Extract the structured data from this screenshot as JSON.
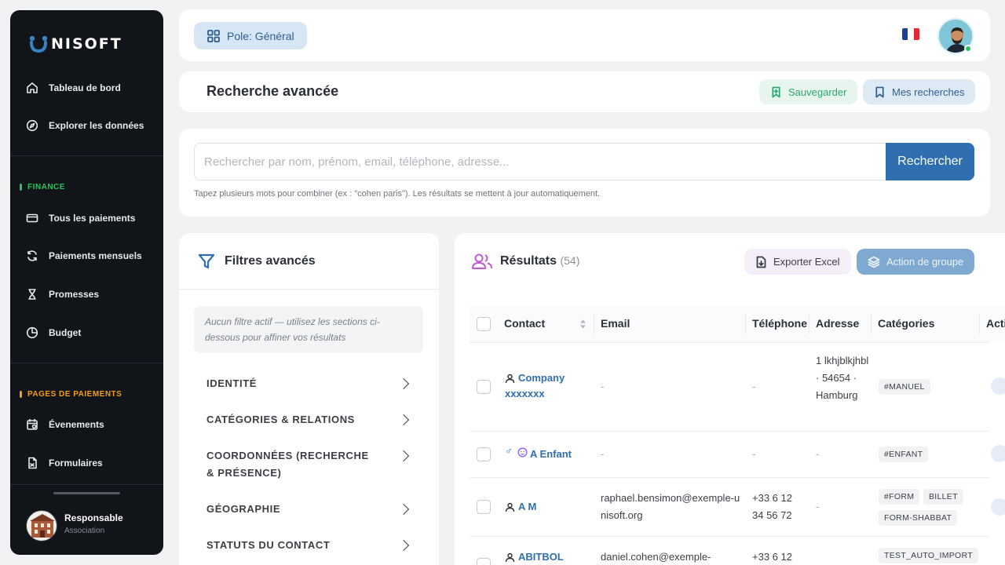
{
  "sidebar": {
    "brand": "NISOFT",
    "items_top": [
      {
        "label": "Tableau de bord",
        "icon": "home-icon"
      },
      {
        "label": "Explorer les données",
        "icon": "compass-icon"
      }
    ],
    "finance": {
      "label": "FINANCE",
      "color": "#22c55e",
      "items": [
        {
          "label": "Tous les paiements",
          "icon": "credit-card-icon"
        },
        {
          "label": "Paiements mensuels",
          "icon": "refresh-icon"
        },
        {
          "label": "Promesses",
          "icon": "hourglass-icon"
        },
        {
          "label": "Budget",
          "icon": "pie-chart-icon"
        }
      ]
    },
    "payments_pages": {
      "label": "PAGES DE PAIEMENTS",
      "color": "#f59e0b",
      "items": [
        {
          "label": "Évenements",
          "icon": "calendar-icon"
        },
        {
          "label": "Formulaires",
          "icon": "form-icon"
        }
      ]
    },
    "user": {
      "role": "Responsable",
      "type": "Association"
    }
  },
  "topbar": {
    "pole_label": "Pole: Général",
    "flag": "france-flag"
  },
  "header": {
    "title": "Recherche avancée",
    "save_label": "Sauvegarder",
    "my_searches_label": "Mes recherches"
  },
  "search": {
    "placeholder": "Rechercher par nom, prénom, email, téléphone, adresse...",
    "button": "Rechercher",
    "hint": "Tapez plusieurs mots pour combiner (ex : \"cohen paris\"). Les résultats se mettent à jour automatiquement."
  },
  "filters": {
    "title": "Filtres avancés",
    "empty_text": "Aucun filtre actif — utilisez les sections ci-dessous pour affiner vos résultats",
    "sections": [
      "IDENTITÉ",
      "CATÉGORIES & RELATIONS",
      "COORDONNÉES (RECHERCHE & PRÉSENCE)",
      "GÉOGRAPHIE",
      "STATUTS DU CONTACT"
    ]
  },
  "results": {
    "title": "Résultats",
    "count": "(54)",
    "export_label": "Exporter Excel",
    "group_action_label": "Action de groupe",
    "columns": [
      "Contact",
      "Email",
      "Téléphone",
      "Adresse",
      "Catégories",
      "Actions"
    ],
    "rows": [
      {
        "contact": "Company xxxxxxx",
        "email": "-",
        "phone": "-",
        "address": "1 lkhjblkjhbl · 54654 · Hamburg",
        "tags": [
          "#MANUEL"
        ]
      },
      {
        "contact": "A Enfant",
        "email": "-",
        "phone": "-",
        "address": "-",
        "tags": [
          "#ENFANT"
        ]
      },
      {
        "contact": "A M",
        "email": "raphael.bensimon@exemple-unisoft.org",
        "phone": "+33 6 12 34 56 72",
        "address": "-",
        "tags": [
          "#FORM",
          "BILLET",
          "FORM-SHABBAT"
        ]
      },
      {
        "contact": "ABITBOL",
        "email": "daniel.cohen@exemple-",
        "phone": "+33 6 12",
        "address": "",
        "tags": [
          "TEST_AUTO_IMPORT"
        ]
      }
    ]
  }
}
